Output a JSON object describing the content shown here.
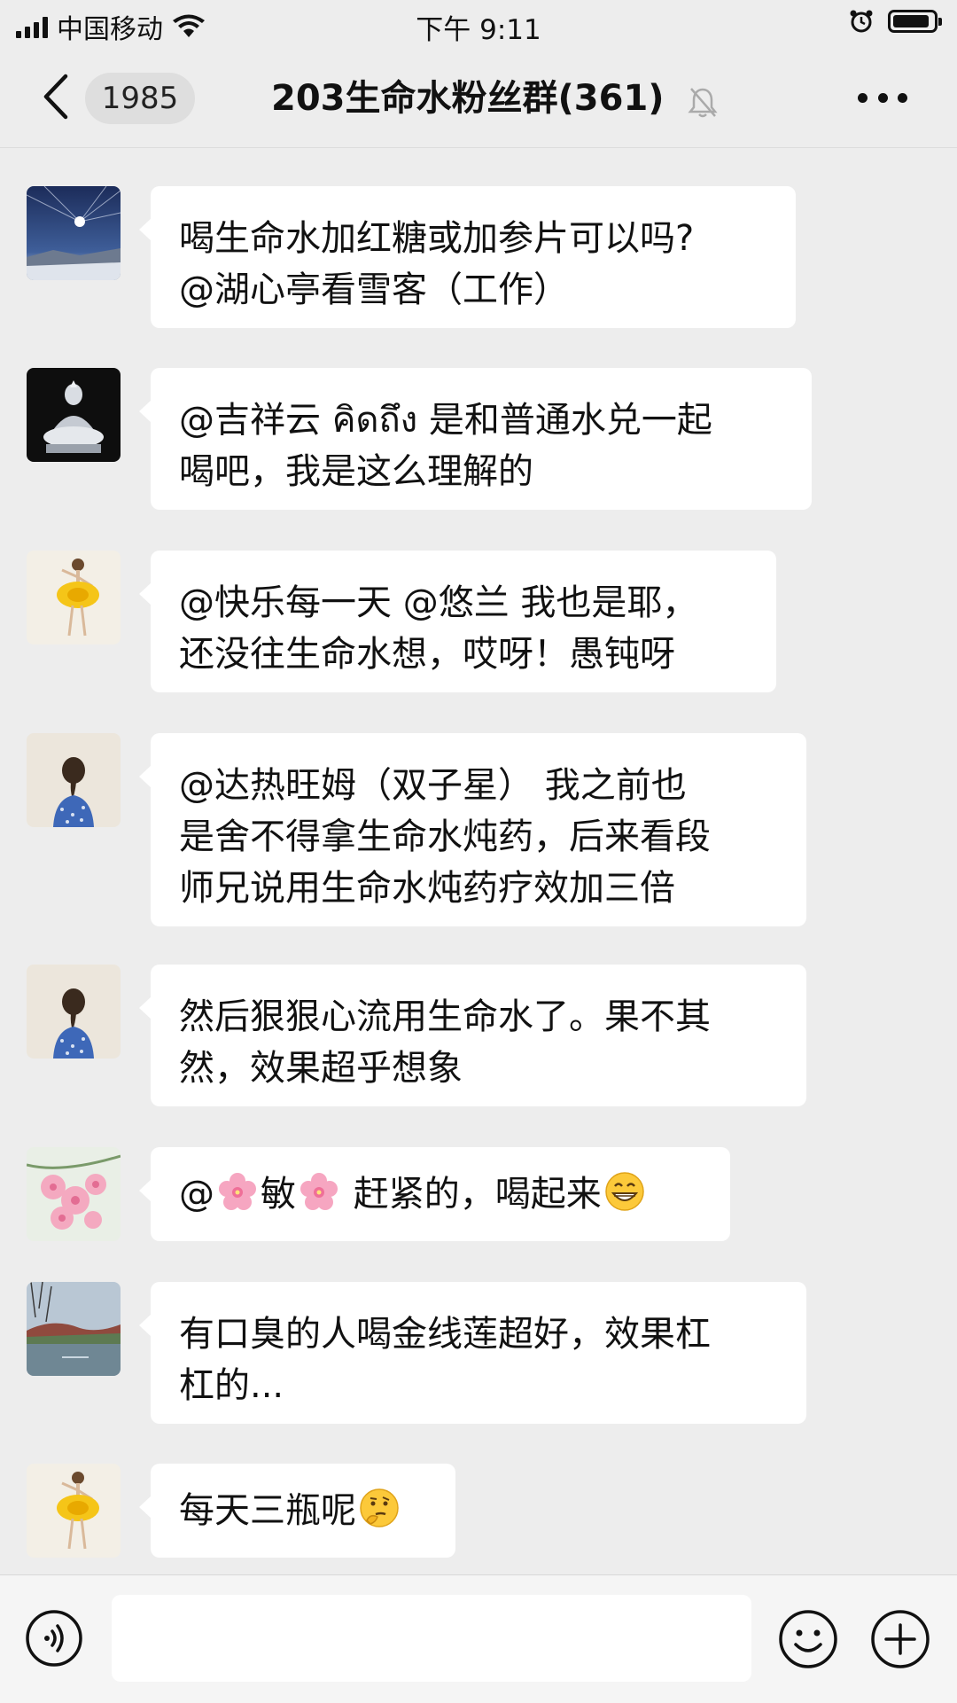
{
  "status_bar": {
    "carrier": "中国移动",
    "time": "下午 9:11"
  },
  "header": {
    "unread_count": "1985",
    "title": "203生命水粉丝群(361)"
  },
  "messages": [
    {
      "avatar": "night-sky-avatar",
      "lines": [
        "喝生命水加红糖或加参片可以吗?",
        "@湖心亭看雪客（工作）"
      ]
    },
    {
      "avatar": "crystal-buddha-avatar",
      "lines": [
        "@吉祥云 คิดถึง  是和普通水兑一起",
        "喝吧，我是这么理解的"
      ]
    },
    {
      "avatar": "ballerina-avatar",
      "lines": [
        "@快乐每一天 @悠兰 我也是耶，",
        "还没往生命水想，哎呀！愚钝呀"
      ]
    },
    {
      "avatar": "braided-girl-avatar",
      "lines": [
        "@达热旺姆（双子星） 我之前也",
        "是舍不得拿生命水炖药，后来看段",
        "师兄说用生命水炖药疗效加三倍"
      ]
    },
    {
      "avatar": "braided-girl-avatar",
      "lines": [
        "然后狠狠心流用生命水了。果不其",
        "然，效果超乎想象"
      ]
    },
    {
      "avatar": "cherry-blossom-avatar",
      "parts": [
        "@",
        "敏",
        " 赶紧的，喝起来"
      ]
    },
    {
      "avatar": "lake-landscape-avatar",
      "lines": [
        "有口臭的人喝金线莲超好，效果杠",
        "杠的..."
      ]
    },
    {
      "avatar": "ballerina-avatar",
      "parts": [
        "每天三瓶呢"
      ]
    }
  ],
  "input_bar": {
    "voice_icon": "voice-icon",
    "emoji_icon": "emoji-icon",
    "plus_icon": "plus-icon"
  }
}
